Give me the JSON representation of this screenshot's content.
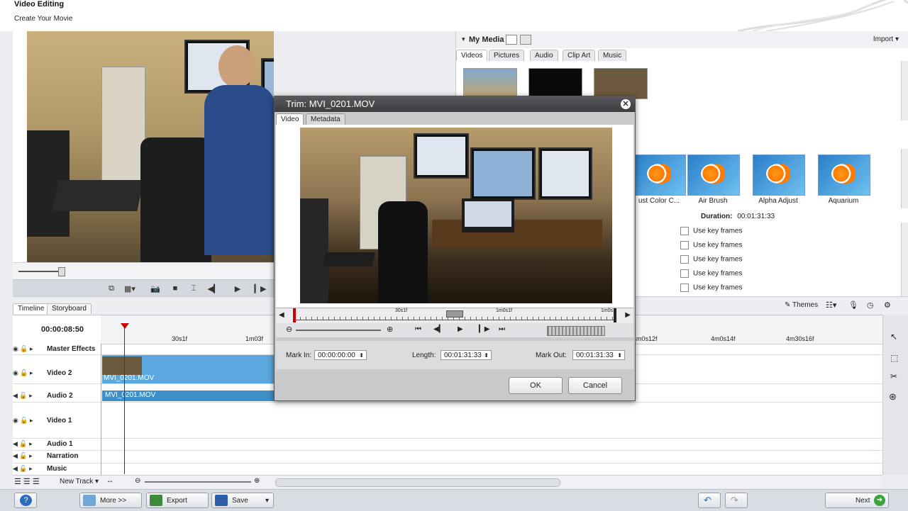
{
  "app": {
    "title": "Video Editing",
    "subtitle": "Create Your Movie"
  },
  "media": {
    "header": "My Media",
    "import_label": "Import",
    "tabs": [
      "Videos",
      "Pictures",
      "Audio",
      "Clip Art",
      "Music"
    ],
    "active_tab": "Videos"
  },
  "effects": {
    "items": [
      "ust Color C...",
      "Air Brush",
      "Alpha Adjust",
      "Aquarium"
    ]
  },
  "properties": {
    "duration_label": "Duration:",
    "duration_value": "00:01:31:33",
    "keyframe_label": "Use key frames",
    "rows": 5
  },
  "themes": {
    "label": "Themes"
  },
  "timeline": {
    "tabs": [
      "Timeline",
      "Storyboard"
    ],
    "active_tab": "Timeline",
    "timecode": "00:00:08:50",
    "ruler_labels": [
      "30s1f",
      "1m03f",
      "4m0s12f",
      "4m0s14f",
      "4m30s16f"
    ],
    "tracks": [
      "Master Effects",
      "Video 2",
      "Audio 2",
      "Video 1",
      "Audio 1",
      "Narration",
      "Music"
    ],
    "clip_video": "MVI_0201.MOV",
    "clip_audio": "MVI_0201.MOV",
    "new_track": "New Track"
  },
  "dialog": {
    "title": "Trim: MVI_0201.MOV",
    "tabs": [
      "Video",
      "Metadata"
    ],
    "active_tab": "Video",
    "ruler_labels": [
      "30s1f",
      "1m0s1f",
      "1m0s"
    ],
    "mark_in_label": "Mark In:",
    "mark_in_value": "00:00:00:00",
    "length_label": "Length:",
    "length_value": "00:01:31:33",
    "mark_out_label": "Mark Out:",
    "mark_out_value": "00:01:31:33",
    "ok_label": "OK",
    "cancel_label": "Cancel"
  },
  "statusbar": {
    "more_label": "More >>",
    "export_label": "Export",
    "save_label": "Save",
    "next_label": "Next"
  },
  "colors": {
    "clip": "#4f9fd8",
    "playhead": "#cc0000",
    "dialog_title_bg": "#3d3d41"
  }
}
